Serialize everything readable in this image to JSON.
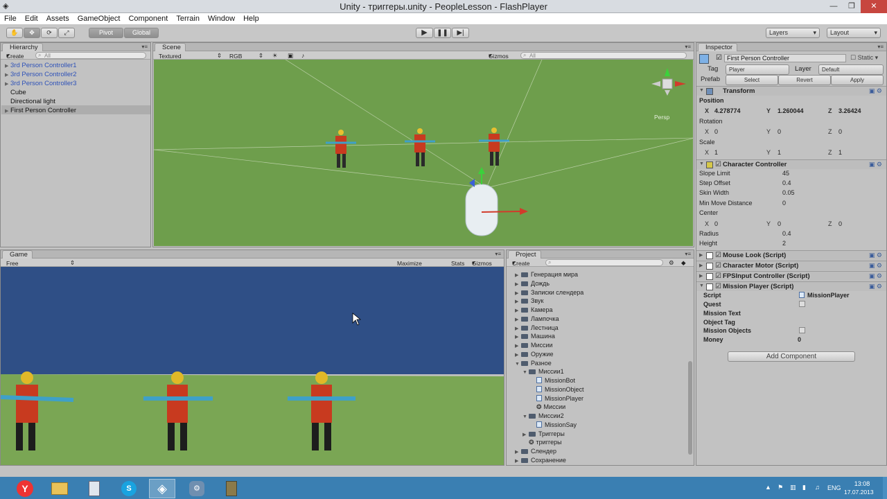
{
  "window": {
    "title": "Unity - триггеры.unity - PeopleLesson - FlashPlayer"
  },
  "menu": [
    "File",
    "Edit",
    "Assets",
    "GameObject",
    "Component",
    "Terrain",
    "Window",
    "Help"
  ],
  "toolbar": {
    "pivot": "Pivot",
    "global": "Global",
    "layers": "Layers",
    "layout": "Layout"
  },
  "hierarchy": {
    "tab": "Hierarchy",
    "create": "Create",
    "search": "All",
    "items": [
      {
        "label": "3rd Person Controller1",
        "prefab": true
      },
      {
        "label": "3rd Person Controller2",
        "prefab": true
      },
      {
        "label": "3rd Person Controller3",
        "prefab": true
      },
      {
        "label": "Cube",
        "prefab": false
      },
      {
        "label": "Directional light",
        "prefab": false
      },
      {
        "label": "First Person Controller",
        "prefab": false
      }
    ]
  },
  "scene": {
    "tab": "Scene",
    "shading": "Textured",
    "render": "RGB",
    "gizmos": "Gizmos",
    "search": "All",
    "persp": "Persp"
  },
  "game": {
    "tab": "Game",
    "aspect": "Free Aspect",
    "maximize": "Maximize on Play",
    "stats": "Stats",
    "gizmos": "Gizmos"
  },
  "project": {
    "tab": "Project",
    "create": "Create",
    "items": [
      {
        "label": "Генерация мира",
        "level": 0,
        "type": "folder",
        "open": false
      },
      {
        "label": "Дождь",
        "level": 0,
        "type": "folder",
        "open": false
      },
      {
        "label": "Записки слендера",
        "level": 0,
        "type": "folder",
        "open": false
      },
      {
        "label": "Звук",
        "level": 0,
        "type": "folder",
        "open": false
      },
      {
        "label": "Камера",
        "level": 0,
        "type": "folder",
        "open": false
      },
      {
        "label": "Лампочка",
        "level": 0,
        "type": "folder",
        "open": false
      },
      {
        "label": "Лестница",
        "level": 0,
        "type": "folder",
        "open": false
      },
      {
        "label": "Машина",
        "level": 0,
        "type": "folder",
        "open": false
      },
      {
        "label": "Миссии",
        "level": 0,
        "type": "folder",
        "open": false
      },
      {
        "label": "Оружие",
        "level": 0,
        "type": "folder",
        "open": false
      },
      {
        "label": "Разное",
        "level": 0,
        "type": "folder",
        "open": true
      },
      {
        "label": "Миссии1",
        "level": 1,
        "type": "folder",
        "open": true
      },
      {
        "label": "MissionBot",
        "level": 2,
        "type": "script"
      },
      {
        "label": "MissionObject",
        "level": 2,
        "type": "script"
      },
      {
        "label": "MissionPlayer",
        "level": 2,
        "type": "script"
      },
      {
        "label": "Миссии",
        "level": 2,
        "type": "scene"
      },
      {
        "label": "Миссии2",
        "level": 1,
        "type": "folder",
        "open": true
      },
      {
        "label": "MissionSay",
        "level": 2,
        "type": "script"
      },
      {
        "label": "Триггеры",
        "level": 1,
        "type": "folder",
        "open": false
      },
      {
        "label": "триггеры",
        "level": 1,
        "type": "scene"
      },
      {
        "label": "Слендер",
        "level": 0,
        "type": "folder",
        "open": false
      },
      {
        "label": "Сохранение",
        "level": 0,
        "type": "folder",
        "open": false
      }
    ]
  },
  "inspector": {
    "tab": "Inspector",
    "object_name": "First Person Controller",
    "static": "Static",
    "tag_label": "Tag",
    "tag": "Player",
    "layer_label": "Layer",
    "layer": "Default",
    "prefab_label": "Prefab",
    "prefab_select": "Select",
    "prefab_revert": "Revert",
    "prefab_apply": "Apply",
    "transform": {
      "title": "Transform",
      "position_label": "Position",
      "pos_x": "4.278774",
      "pos_y": "1.260044",
      "pos_z": "3.26424",
      "rotation_label": "Rotation",
      "rot_x": "0",
      "rot_y": "0",
      "rot_z": "0",
      "scale_label": "Scale",
      "scl_x": "1",
      "scl_y": "1",
      "scl_z": "1"
    },
    "character_controller": {
      "title": "Character Controller",
      "slope_label": "Slope Limit",
      "slope": "45",
      "step_label": "Step Offset",
      "step": "0.4",
      "skin_label": "Skin Width",
      "skin": "0.05",
      "minmove_label": "Min Move Distance",
      "minmove": "0",
      "center_label": "Center",
      "c_x": "0",
      "c_y": "0",
      "c_z": "0",
      "radius_label": "Radius",
      "radius": "0.4",
      "height_label": "Height",
      "height": "2"
    },
    "scripts": [
      "Mouse Look (Script)",
      "Character Motor (Script)",
      "FPSInput Controller (Script)",
      "Mission Player (Script)"
    ],
    "mission_player": {
      "script_label": "Script",
      "script": "MissionPlayer",
      "quest_label": "Quest",
      "mission_text_label": "Mission Text",
      "object_tag_label": "Object Tag",
      "mission_objects_label": "Mission Objects",
      "money_label": "Money",
      "money": "0"
    },
    "add_component": "Add Component"
  },
  "taskbar": {
    "lang": "ENG",
    "time": "13:08",
    "date": "17.07.2013"
  },
  "colors": {
    "grass": "#6e9e4c",
    "sky": "#2f4f86",
    "accent": "#3a7fb2"
  }
}
